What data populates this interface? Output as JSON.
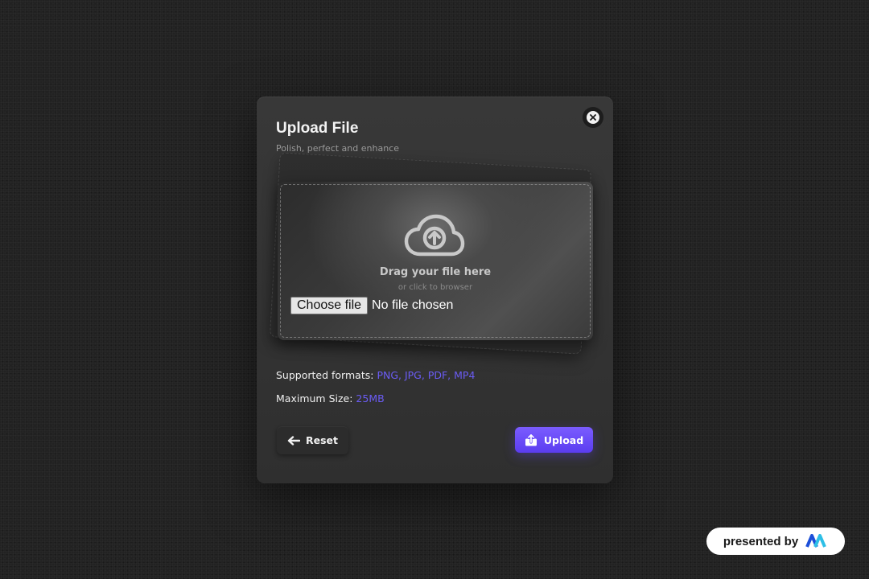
{
  "modal": {
    "title": "Upload File",
    "subtitle": "Polish, perfect and enhance",
    "close_icon": "close-icon"
  },
  "drop_zone": {
    "icon": "cloud-upload-icon",
    "drag_text": "Drag your file here",
    "or_text": "or click to browser",
    "choose_file_label": "Choose file",
    "file_status": "No file chosen"
  },
  "info": {
    "formats_label": "Supported formats:",
    "formats_value": "PNG, JPG, PDF, MP4",
    "size_label": "Maximum Size:",
    "size_value": "25MB"
  },
  "actions": {
    "reset_label": "Reset",
    "reset_icon": "arrow-left-icon",
    "upload_label": "Upload",
    "upload_icon": "upload-icon"
  },
  "badge": {
    "label": "presented by",
    "logo": "brand-logo-icon"
  },
  "colors": {
    "accent": "#6b5cf5",
    "button_gradient_top": "#7b5cff",
    "button_gradient_bottom": "#5b3df0"
  }
}
